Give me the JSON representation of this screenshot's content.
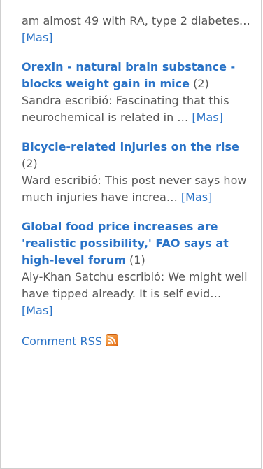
{
  "intro": {
    "text": "am almost 49 with RA, type 2 diabetes… ",
    "more_label": "[Mas]"
  },
  "entries": [
    {
      "title": "Orexin - natural brain substance - blocks weight gain in mice",
      "count": "(2)",
      "excerpt": "Sandra escribió: Fascinating that this neurochemical is related in … ",
      "more_label": "[Mas]"
    },
    {
      "title": "Bicycle-related injuries on the rise",
      "count": "(2)",
      "excerpt": "Ward escribió: This post never says how much injuries have increa… ",
      "more_label": "[Mas]"
    },
    {
      "title": "Global food price increases are 'realistic possibility,' FAO says at high-level forum",
      "count": "(1)",
      "excerpt": "Aly-Khan Satchu escribió: We might well have tipped already. It is self evid… ",
      "more_label": "[Mas]"
    }
  ],
  "footer": {
    "rss_label": "Comment RSS",
    "rss_icon": "rss-feed-icon",
    "rss_color": "#f58220"
  }
}
